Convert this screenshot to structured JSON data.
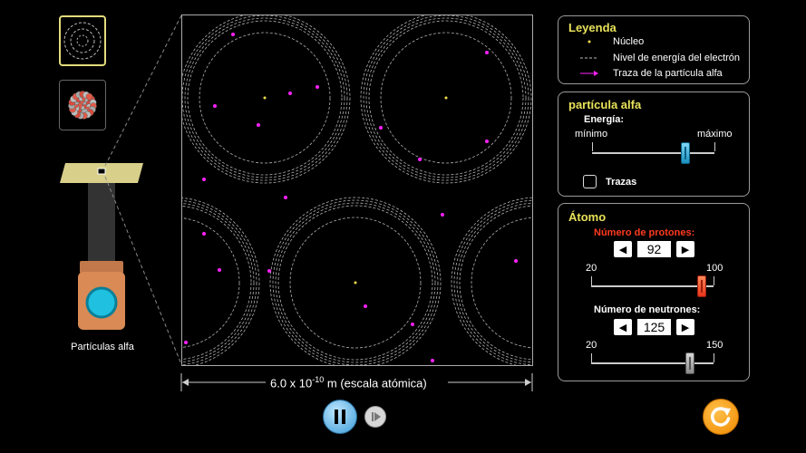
{
  "views": [
    {
      "name": "atom-view",
      "selected": true
    },
    {
      "name": "nucleus-view",
      "selected": false
    }
  ],
  "source": {
    "label": "Partículas alfa"
  },
  "scale_label_base": "6.0 x 10",
  "scale_exponent": "-10",
  "scale_label_rest": " m (escala atómica)",
  "legend": {
    "title": "Leyenda",
    "items": [
      "Núcleo",
      "Nivel de energía del electrón",
      "Traza de la partícula alfa"
    ]
  },
  "alpha": {
    "title": "partícula alfa",
    "energy_label": "Energía:",
    "min_label": "mínimo",
    "max_label": "máximo",
    "energy_level": 0.76,
    "traces_label": "Trazas",
    "traces_checked": false
  },
  "atom": {
    "title": "Átomo",
    "protons_label": "Número de protones:",
    "protons_value": "92",
    "protons_min": "20",
    "protons_max": "100",
    "neutrons_label": "Número de neutrones:",
    "neutrons_value": "125",
    "neutrons_min": "20",
    "neutrons_max": "150"
  },
  "colors": {
    "accent_yellow": "#e8e25a",
    "protons_red": "#ff3b1f",
    "particle_magenta": "#ff22ff",
    "nucleus_yellow": "#f4e04a",
    "emitter_cyan": "#1fc0e0"
  }
}
